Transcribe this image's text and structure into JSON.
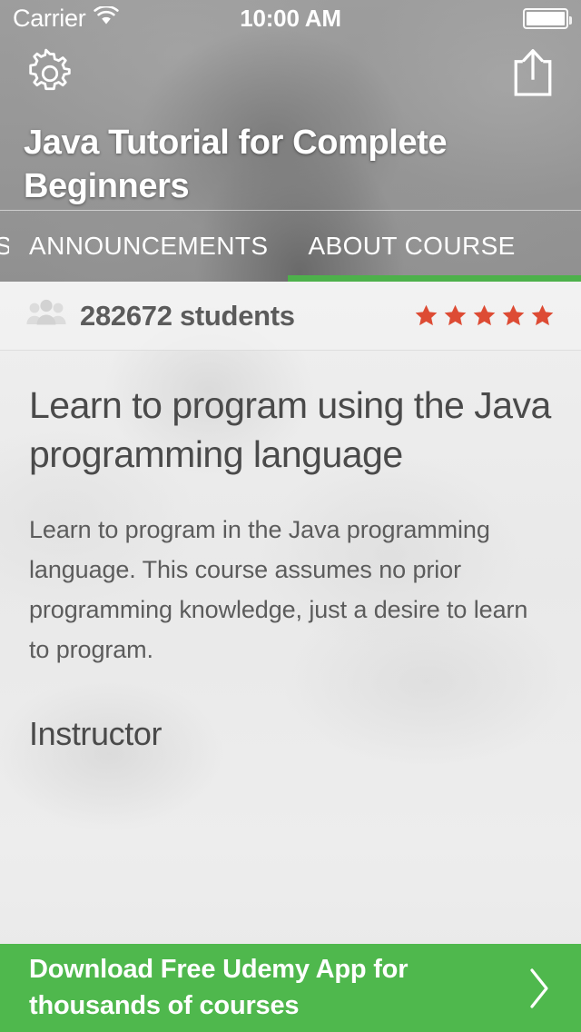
{
  "status_bar": {
    "carrier": "Carrier",
    "wifi_icon": "wifi-icon",
    "time": "10:00 AM",
    "battery_icon": "battery-icon"
  },
  "nav": {
    "settings_icon": "gear-icon",
    "share_icon": "share-icon"
  },
  "header": {
    "course_title": "Java Tutorial for Complete Beginners"
  },
  "tabs": [
    {
      "label": "S",
      "active": false,
      "partial": true
    },
    {
      "label": "ANNOUNCEMENTS",
      "active": false,
      "partial": false
    },
    {
      "label": "ABOUT COURSE",
      "active": true,
      "partial": false
    }
  ],
  "stats": {
    "people_icon": "people-icon",
    "students_count": "282672 students",
    "rating_stars": 5,
    "star_color": "#dd4b34"
  },
  "about": {
    "headline": "Learn to program using the Java programming language",
    "description": "Learn to program in the Java programming language. This course assumes no prior programming knowledge, just a desire to learn to program.",
    "instructor_heading": "Instructor"
  },
  "banner": {
    "text": "Download Free Udemy App for thousands of courses",
    "chevron_icon": "chevron-right-icon",
    "background_color": "#4fb84d"
  },
  "colors": {
    "accent_green": "#4db14b",
    "star_orange": "#dd4b34",
    "text_dark": "#4a4a4a"
  }
}
